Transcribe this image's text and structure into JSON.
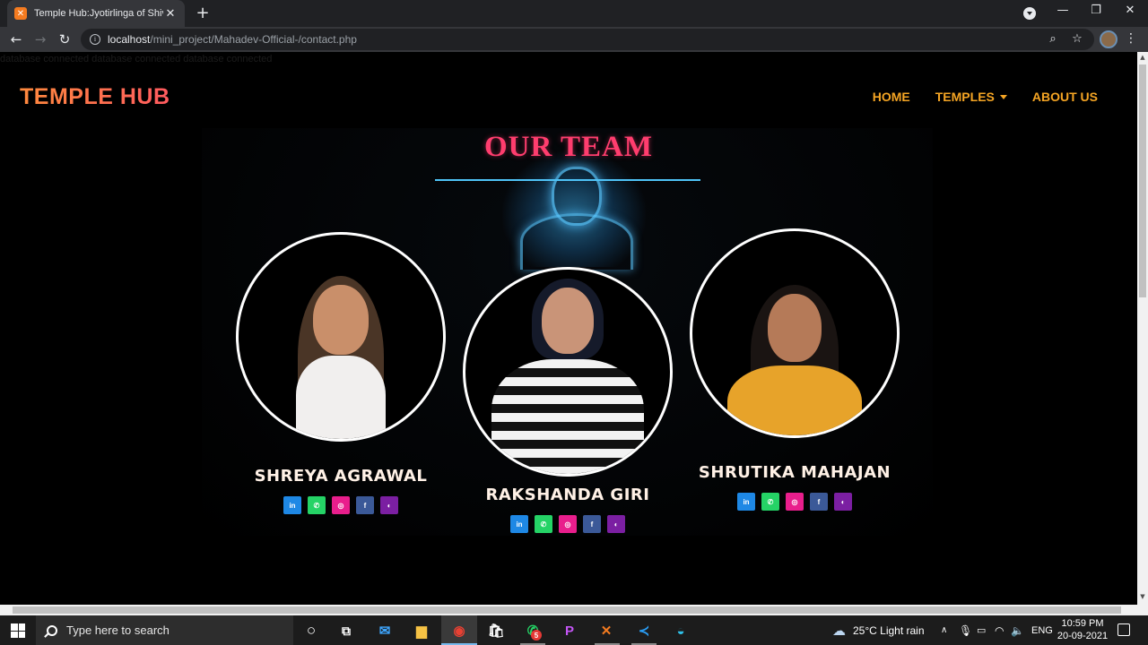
{
  "browser": {
    "tab_title": "Temple Hub:Jyotirlinga of Shiva",
    "tab_close": "✕",
    "new_tab": "+",
    "url_host": "localhost",
    "url_path": "/mini_project/Mahadev-Official-/contact.php",
    "window_controls": [
      "—",
      "❐",
      "✕"
    ]
  },
  "page": {
    "debug_text": "database connected database connected database connected",
    "brand": "TEMPLE HUB",
    "nav": [
      {
        "label": "HOME"
      },
      {
        "label": "TEMPLES",
        "has_caret": true
      },
      {
        "label": "ABOUT US"
      }
    ],
    "section_title": "OUR TEAM",
    "members": [
      {
        "name": "SHREYA AGRAWAL"
      },
      {
        "name": "RAKSHANDA GIRI"
      },
      {
        "name": "SHRUTIKA MAHAJAN"
      }
    ],
    "socials": [
      {
        "icon": "linkedin-icon",
        "glyph": "in",
        "color": "#1e88e5"
      },
      {
        "icon": "whatsapp-icon",
        "glyph": "✆",
        "color": "#25d366"
      },
      {
        "icon": "instagram-icon",
        "glyph": "◎",
        "color": "#e91e8c"
      },
      {
        "icon": "facebook-icon",
        "glyph": "f",
        "color": "#3b5998"
      },
      {
        "icon": "github-icon",
        "glyph": "◐",
        "color": "#7b1fa2"
      }
    ]
  },
  "taskbar": {
    "search_placeholder": "Type here to search",
    "weather": "25°C  Light rain",
    "language": "ENG",
    "time": "10:59 PM",
    "date": "20-09-2021",
    "whatsapp_badge": "5"
  },
  "colors": {
    "brand_gradient_start": "#ff8a3d",
    "brand_gradient_end": "#ff5a5f",
    "nav": "#f5a524",
    "title": "#ff3d6e",
    "title_underline": "#4fc3f7"
  }
}
